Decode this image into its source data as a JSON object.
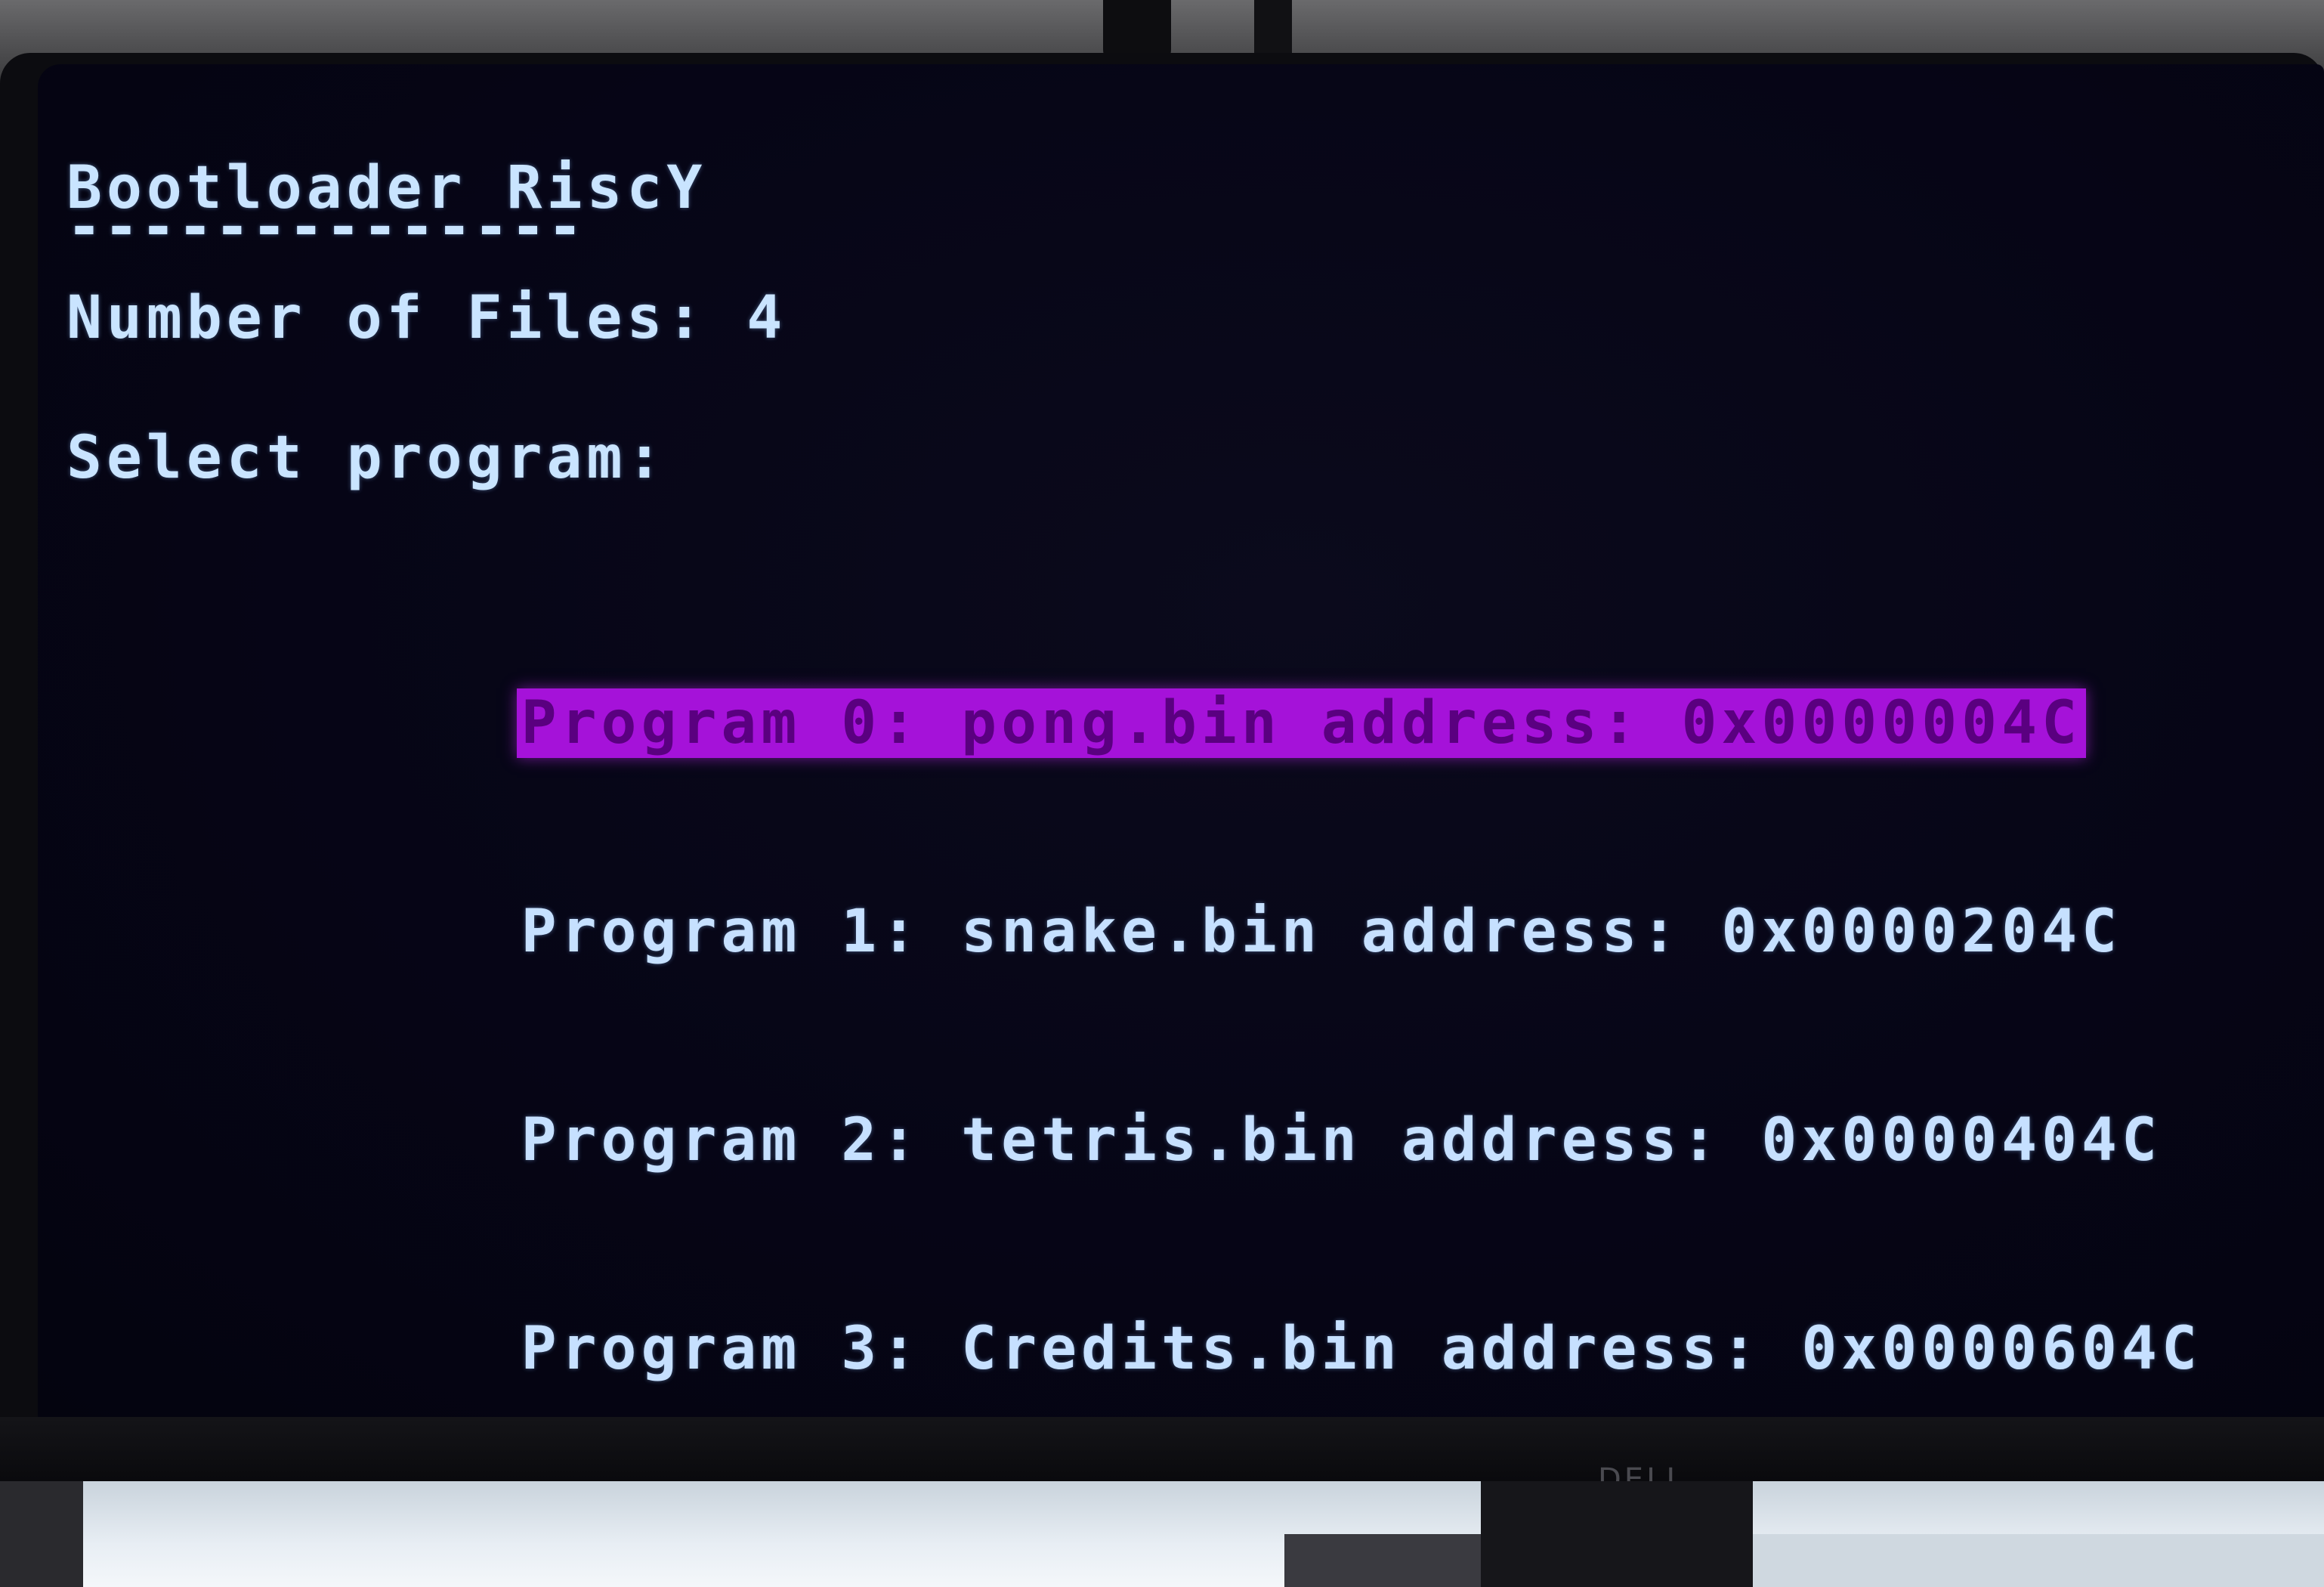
{
  "terminal": {
    "title": "Bootloader RiscY",
    "divider": "--------------",
    "file_count_line": "Number of Files: 4",
    "prompt": "Select program:"
  },
  "programs": [
    {
      "label": "Program 0: pong.bin address: 0x0000004C",
      "selected": true
    },
    {
      "label": "Program 1: snake.bin address: 0x0000204C",
      "selected": false
    },
    {
      "label": "Program 2: tetris.bin address: 0x0000404C",
      "selected": false
    },
    {
      "label": "Program 3: Credits.bin address: 0x0000604C",
      "selected": false
    }
  ],
  "monitor": {
    "brand": "DELL"
  },
  "colors": {
    "text": "#c9e4ff",
    "highlight": "#a512d9",
    "highlight_text": "#5a0080",
    "screen_bg": "#060516"
  }
}
